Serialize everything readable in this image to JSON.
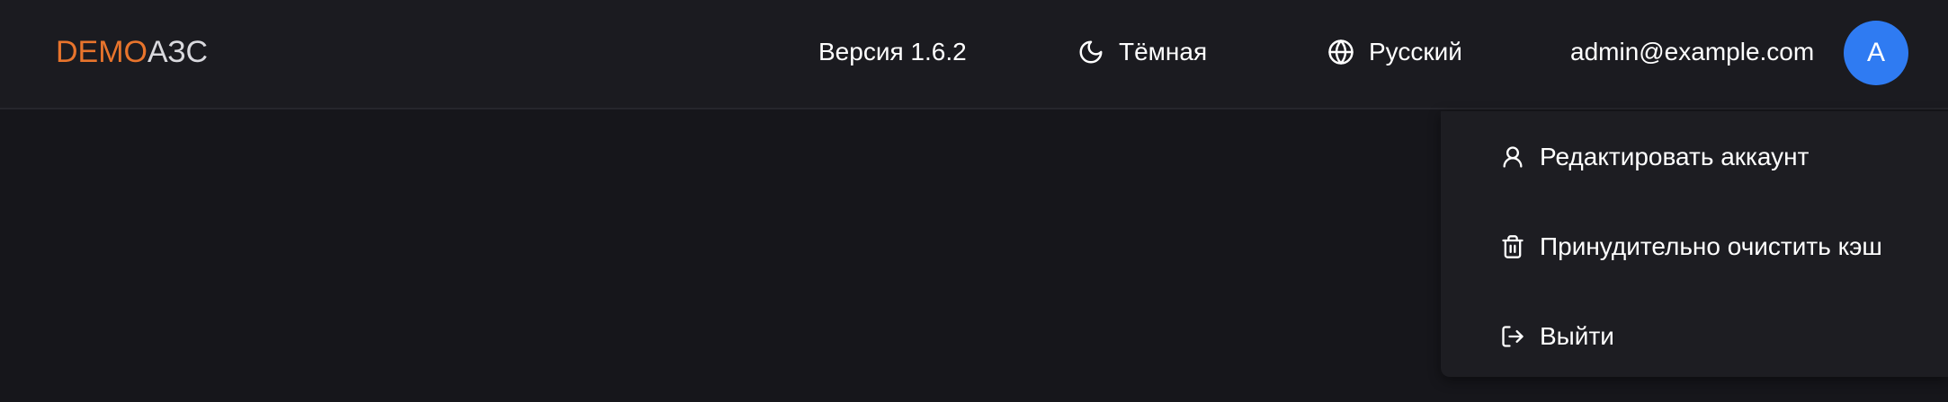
{
  "header": {
    "logo_accent": "DEMO",
    "logo_rest": "АЗС",
    "version": "Версия 1.6.2",
    "theme_label": "Тёмная",
    "language_label": "Русский",
    "user_email": "admin@example.com",
    "avatar_letter": "A"
  },
  "user_menu": {
    "items": [
      {
        "label": "Редактировать аккаунт",
        "icon": "user-icon"
      },
      {
        "label": "Принудительно очистить кэш",
        "icon": "trash-icon"
      },
      {
        "label": "Выйти",
        "icon": "logout-icon"
      }
    ]
  },
  "colors": {
    "background": "#16161b",
    "header": "#1b1b20",
    "logo_accent": "#e8742c",
    "avatar": "#2f7bf2"
  }
}
